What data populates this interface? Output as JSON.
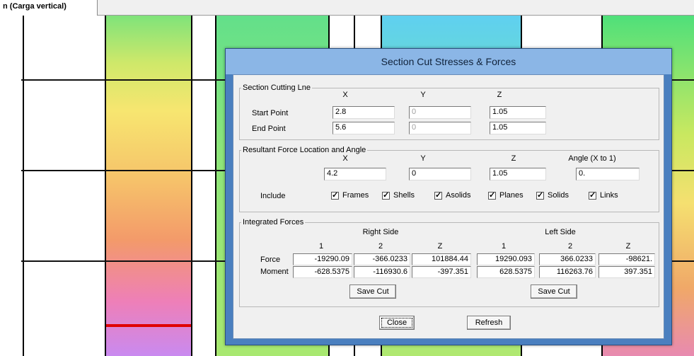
{
  "tab": {
    "label": "n  (Carga vertical)"
  },
  "dialog": {
    "title": "Section Cut Stresses & Forces",
    "cutting_line": {
      "legend": "Section Cutting Lne",
      "headers": [
        "X",
        "Y",
        "Z"
      ],
      "start_label": "Start Point",
      "end_label": "End Point",
      "start": {
        "x": "2.8",
        "y": "0",
        "z": "1.05"
      },
      "end": {
        "x": "5.6",
        "y": "0",
        "z": "1.05"
      }
    },
    "resultant": {
      "legend": "Resultant Force Location and Angle",
      "headers": [
        "X",
        "Y",
        "Z",
        "Angle (X to 1)"
      ],
      "values": {
        "x": "4.2",
        "y": "0",
        "z": "1.05",
        "angle": "0."
      },
      "include_label": "Include",
      "include": [
        "Frames",
        "Shells",
        "Asolids",
        "Planes",
        "Solids",
        "Links"
      ]
    },
    "integrated": {
      "legend": "Integrated Forces",
      "right_label": "Right Side",
      "left_label": "Left Side",
      "col_headers": [
        "1",
        "2",
        "Z"
      ],
      "force_label": "Force",
      "moment_label": "Moment",
      "right_force": [
        "-19290.09",
        "-366.0233",
        "101884.44"
      ],
      "right_moment": [
        "-628.5375",
        "-116930.6",
        "-397.351"
      ],
      "left_force": [
        "19290.093",
        "366.0233",
        "-98621."
      ],
      "left_moment": [
        "628.5375",
        "116263.76",
        "397.351"
      ],
      "save_label": "Save Cut"
    },
    "close_label": "Close",
    "refresh_label": "Refresh"
  }
}
